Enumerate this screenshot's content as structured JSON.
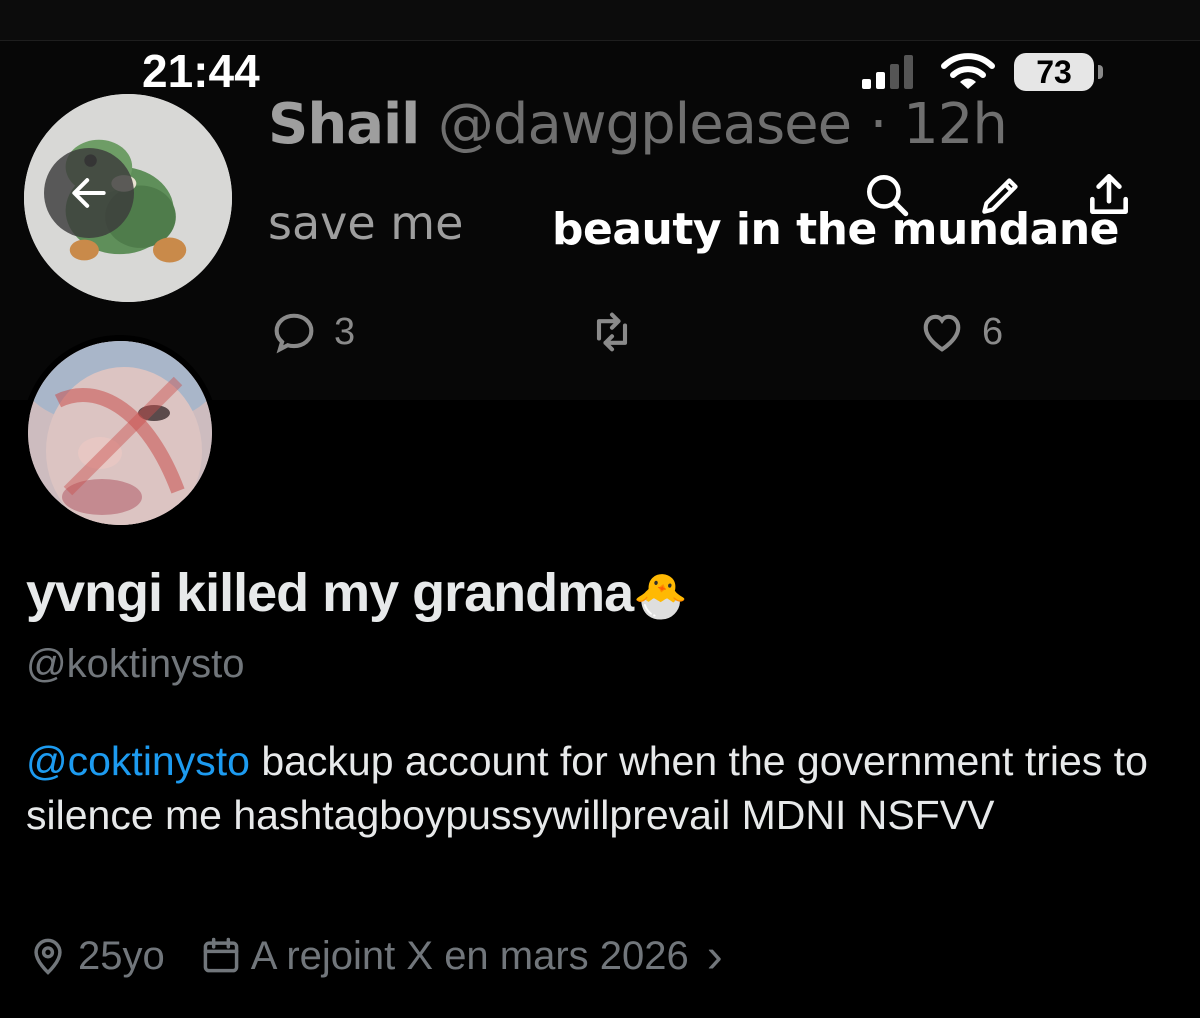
{
  "status_bar": {
    "time": "21:44",
    "battery": "73"
  },
  "banner": {
    "tweet_name": "Shail",
    "tweet_handle": "@dawgpleasee",
    "tweet_time": "· 12h",
    "tweet_text": "save me",
    "overlay_text": "beauty in the mundane",
    "reply_count": "3",
    "like_count": "6"
  },
  "profile": {
    "display_name": "yvngi killed my grandma",
    "emoji": "🐣",
    "handle": "@koktinysto",
    "bio_mention": "@coktinysto",
    "bio_text": " backup account for when the government tries to silence me hashtagboypussywillprevail MDNI NSFVV",
    "location": "25yo",
    "joined": "A rejoint X en mars 2026",
    "joined_chevron": "›"
  },
  "colors": {
    "background": "#000000",
    "text": "#e7e9ea",
    "muted": "#71767b",
    "link": "#1d9bf0"
  },
  "icons": {
    "back": "arrow-left-icon",
    "search": "search-icon",
    "compose": "pencil-icon",
    "share": "share-icon",
    "location": "location-pin-icon",
    "calendar": "calendar-icon"
  }
}
